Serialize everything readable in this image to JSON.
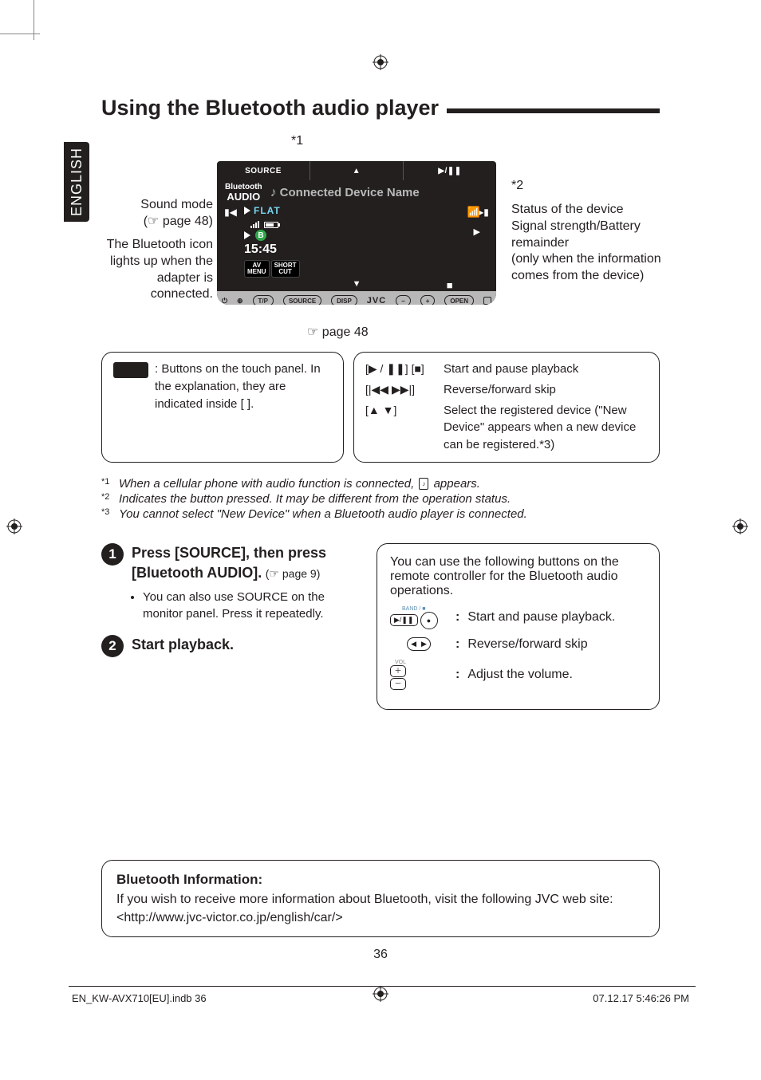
{
  "language_tab": "ENGLISH",
  "title": "Using the Bluetooth audio player",
  "stars": {
    "s1": "*1",
    "s2": "*2",
    "s3": "*3"
  },
  "screen": {
    "top_source": "SOURCE",
    "bt_line1": "Bluetooth",
    "bt_line2": "AUDIO",
    "device_name": "Connected Device Name",
    "flat": "FLAT",
    "time": "15:45",
    "low1_a": "AV",
    "low1_b": "MENU",
    "low2_a": "SHORT",
    "low2_b": "CUT",
    "jvc": "JVC",
    "bottom_pills": [
      "T/P",
      "SOURCE",
      "DISP",
      "−",
      "+",
      "OPEN"
    ]
  },
  "annotations": {
    "sound_mode": "Sound mode",
    "sound_mode_ref": "(☞ page 48)",
    "bt_icon_text": "The Bluetooth icon lights up when the adapter is connected.",
    "status_label": "Status of the device",
    "status_detail": "Signal strength/Battery remainder\n(only when the information comes from the device)",
    "page48": "☞ page 48"
  },
  "box_left": "Buttons on the touch panel. In the explanation, they are indicated inside [       ].",
  "box_right": {
    "sym1": "[▶ / ❚❚] [■]",
    "desc1": "Start and pause playback",
    "sym2": "[|◀◀ ▶▶|]",
    "desc2": "Reverse/forward skip",
    "sym3": "[▲ ▼]",
    "desc3": "Select the registered device (\"New Device\" appears when a new device can be registered.*3)"
  },
  "footnotes": {
    "f1": "When a cellular phone with audio function is connected,",
    "f1b": "appears.",
    "f2": "Indicates the button pressed. It may be different from the operation status.",
    "f3": "You cannot select \"New Device\" when a Bluetooth audio player is connected."
  },
  "steps": {
    "s1_lead": "Press [SOURCE], then press [Bluetooth AUDIO].",
    "s1_ref": "(☞ page 9)",
    "s1_bullet": "You can also use SOURCE on the monitor panel. Press it repeatedly.",
    "s2_lead": "Start playback."
  },
  "remote": {
    "intro": "You can use the following buttons on the remote controller for the Bluetooth audio operations.",
    "band_label": "BAND / ■",
    "vol_label": "VOL",
    "r1": "Start and pause playback.",
    "r2": "Reverse/forward skip",
    "r3": "Adjust the volume."
  },
  "bt_info": {
    "heading": "Bluetooth Information:",
    "body": "If you wish to receive more information about Bluetooth, visit the following JVC web site: <http://www.jvc-victor.co.jp/english/car/>"
  },
  "page_number": "36",
  "footer": {
    "left": "EN_KW-AVX710[EU].indb   36",
    "right": "07.12.17   5:46:26 PM"
  }
}
